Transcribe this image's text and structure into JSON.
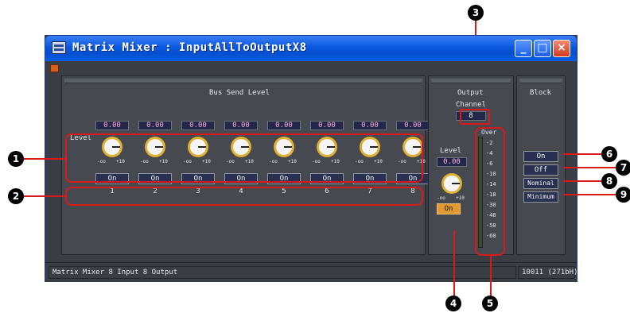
{
  "window": {
    "title": "Matrix Mixer : InputAllToOutputX8",
    "minimize_glyph": "_",
    "maximize_glyph": "□",
    "close_glyph": "×"
  },
  "bus_send": {
    "title": "Bus Send Level",
    "row_label": "Level",
    "channels": [
      {
        "value": "0.00",
        "on_label": "On",
        "number": "1"
      },
      {
        "value": "0.00",
        "on_label": "On",
        "number": "2"
      },
      {
        "value": "0.00",
        "on_label": "On",
        "number": "3"
      },
      {
        "value": "0.00",
        "on_label": "On",
        "number": "4"
      },
      {
        "value": "0.00",
        "on_label": "On",
        "number": "5"
      },
      {
        "value": "0.00",
        "on_label": "On",
        "number": "6"
      },
      {
        "value": "0.00",
        "on_label": "On",
        "number": "7"
      },
      {
        "value": "0.00",
        "on_label": "On",
        "number": "8"
      }
    ],
    "knob_min_label": "-oo",
    "knob_max_label": "+10"
  },
  "output": {
    "title": "Output",
    "channel_label": "Channel",
    "channel_value": "8",
    "level_label": "Level",
    "level_value": "0.00",
    "on_label": "On",
    "knob_min_label": "-oo",
    "knob_max_label": "+10"
  },
  "meter": {
    "over_label": "Over",
    "scale": [
      "-2",
      "-4",
      "-6",
      "-10",
      "-14",
      "-18",
      "-30",
      "-40",
      "-50",
      "-60"
    ]
  },
  "block": {
    "title": "Block",
    "buttons": [
      "On",
      "Off",
      "Nominal",
      "Minimum"
    ]
  },
  "status": {
    "left_text": "Matrix Mixer   8 Input 8 Output",
    "right_text": "10011 (271bH)"
  },
  "callouts": [
    "1",
    "2",
    "3",
    "4",
    "5",
    "6",
    "7",
    "8",
    "9"
  ],
  "colors": {
    "callout_line": "#d81a1a",
    "knob": "#e0b030",
    "on_active": "#e09a30"
  }
}
